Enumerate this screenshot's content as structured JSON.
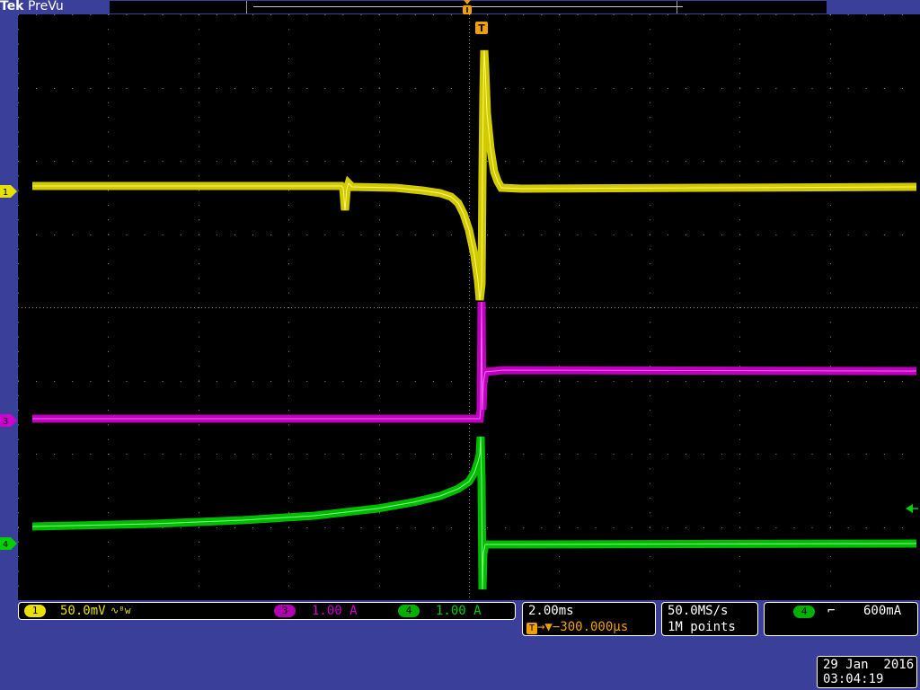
{
  "brand": {
    "tek": "Tek",
    "mode": "PreVu"
  },
  "channels": [
    {
      "id": "1",
      "color": "#e8e000",
      "scale": "50.0mV",
      "bw_symbol": "∿ᴮw"
    },
    {
      "id": "3",
      "color": "#d000d0",
      "scale": "1.00 A"
    },
    {
      "id": "4",
      "color": "#00d000",
      "scale": "1.00 A"
    }
  ],
  "markers": {
    "trigger_top": "T",
    "trigger_on_trace": "T"
  },
  "timebase": {
    "scale": "2.00ms",
    "trigger_icon": "T",
    "delay": "→▼−300.000µs"
  },
  "acquisition": {
    "rate": "50.0MS/s",
    "length": "1M points"
  },
  "trigger": {
    "source": "4",
    "slope": "⌐",
    "level": "600mA"
  },
  "datetime": {
    "date": "29 Jan  2016",
    "time": "03:04:19"
  },
  "colors": {
    "background": "#000000",
    "frame": "#3a3f9a",
    "grid": "#8a8a8a",
    "trigger_orange": "#f0a000"
  }
}
